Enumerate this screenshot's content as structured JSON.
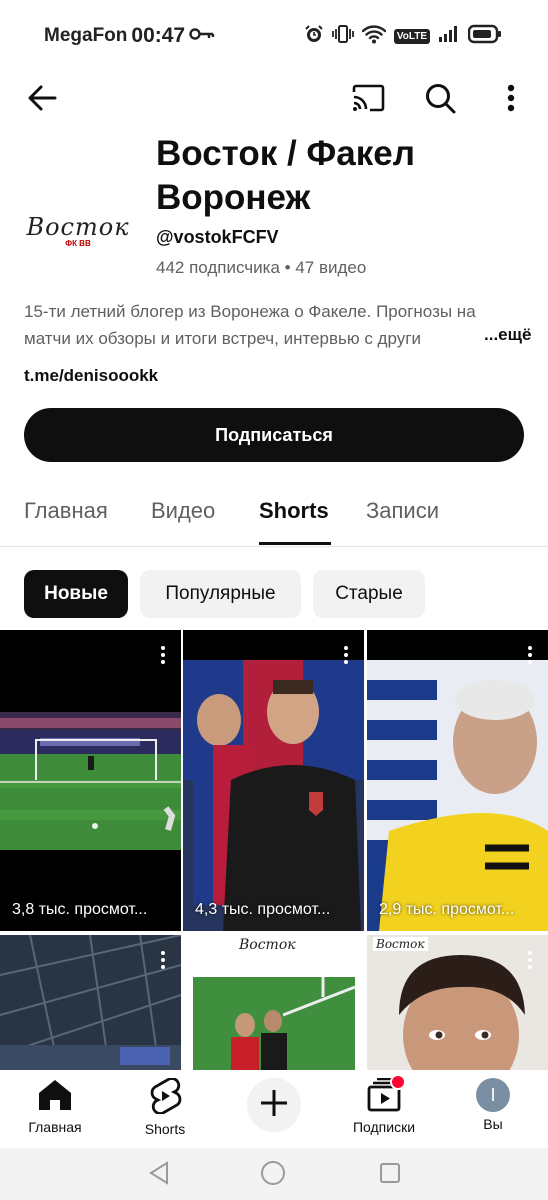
{
  "status_bar": {
    "carrier": "MegaFon",
    "time": "00:47",
    "volte": "VoLTE",
    "icons": [
      "key-icon",
      "alarm-icon",
      "vibrate-icon",
      "wifi-icon",
      "volte-icon",
      "signal-icon",
      "battery-icon"
    ]
  },
  "top_bar": {
    "icons": [
      "back-arrow-icon",
      "cast-icon",
      "search-icon",
      "more-vert-icon"
    ]
  },
  "channel": {
    "avatar_logo_text": "Восток",
    "avatar_logo_sub": "ФК ВВ",
    "title": "Восток / Факел Воронеж",
    "handle": "@vostokFCFV",
    "meta": "442 подписчика • 47 видео",
    "description": "15-ти летний блогер из Воронежа о Факеле. Прогнозы на матчи их обзоры и итоги встреч, интервью с други",
    "more_label": "...ещё",
    "link": "t.me/denisoookk",
    "subscribe_label": "Подписаться"
  },
  "tabs": [
    {
      "label": "Главная"
    },
    {
      "label": "Видео"
    },
    {
      "label": "Shorts",
      "active": true
    },
    {
      "label": "Записи"
    }
  ],
  "chips": [
    {
      "label": "Новые",
      "active": true
    },
    {
      "label": "Популярные"
    },
    {
      "label": "Старые"
    }
  ],
  "shorts": [
    {
      "views": "3,8 тыс. просмот..."
    },
    {
      "views": "4,3 тыс. просмот..."
    },
    {
      "views": "2,9 тыс. просмот..."
    },
    {
      "views": ""
    },
    {
      "views": "",
      "logo": "Восток"
    },
    {
      "views": "",
      "logo": "Восток"
    }
  ],
  "bottom_nav": [
    {
      "label": "Главная",
      "icon": "home-icon"
    },
    {
      "label": "Shorts",
      "icon": "shorts-icon"
    },
    {
      "label": "",
      "icon": "create-plus-icon"
    },
    {
      "label": "Подписки",
      "icon": "subscriptions-icon"
    },
    {
      "label": "Вы",
      "icon": "avatar",
      "avatar_letter": "I"
    }
  ],
  "colors": {
    "text_primary": "#0f0f0f",
    "text_secondary": "#606060",
    "chip_bg": "#f2f2f2",
    "notification_dot": "#ff0033",
    "you_avatar_bg": "#7a8fa3"
  }
}
